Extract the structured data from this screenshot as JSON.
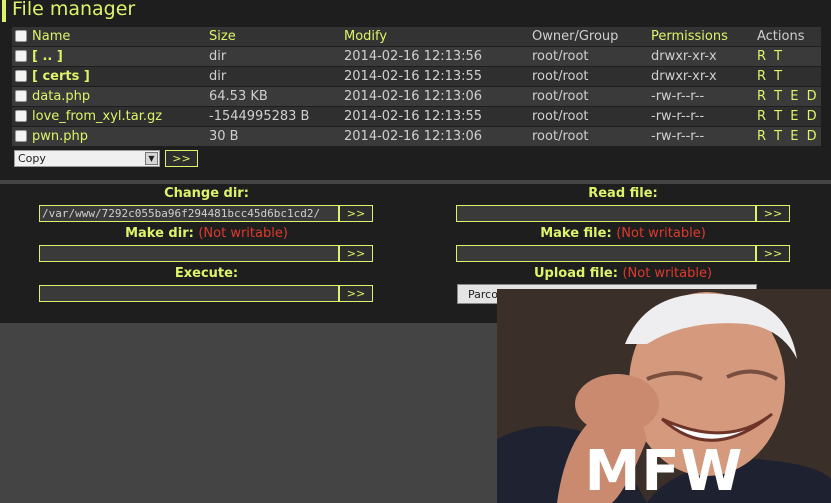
{
  "window": {
    "title": "File manager"
  },
  "table": {
    "headers": {
      "name": "Name",
      "size": "Size",
      "modify": "Modify",
      "owner": "Owner/Group",
      "permissions": "Permissions",
      "actions": "Actions"
    },
    "rows": [
      {
        "name": "[ .. ]",
        "size": "dir",
        "modify": "2014-02-16 12:13:56",
        "owner": "root/root",
        "permissions": "drwxr-xr-x",
        "actions": "R T"
      },
      {
        "name": "[ certs ]",
        "size": "dir",
        "modify": "2014-02-16 12:13:55",
        "owner": "root/root",
        "permissions": "drwxr-xr-x",
        "actions": "R T"
      },
      {
        "name": "data.php",
        "size": "64.53 KB",
        "modify": "2014-02-16 12:13:06",
        "owner": "root/root",
        "permissions": "-rw-r--r--",
        "actions": "R T E D"
      },
      {
        "name": "love_from_xyl.tar.gz",
        "size": "-1544995283 B",
        "modify": "2014-02-16 12:13:55",
        "owner": "root/root",
        "permissions": "-rw-r--r--",
        "actions": "R T E D"
      },
      {
        "name": "pwn.php",
        "size": "30 B",
        "modify": "2014-02-16 12:13:06",
        "owner": "root/root",
        "permissions": "-rw-r--r--",
        "actions": "R T E D"
      }
    ]
  },
  "bulk": {
    "selected": "Copy",
    "submit": ">>"
  },
  "tools": {
    "change_dir": {
      "label": "Change dir:",
      "value": "/var/www/7292c055ba96f294481bcc45d6bc1cd2/",
      "submit": ">>"
    },
    "read_file": {
      "label": "Read file:",
      "value": "",
      "submit": ">>"
    },
    "make_dir": {
      "label": "Make dir:",
      "warning": "(Not writable)",
      "value": "",
      "submit": ">>"
    },
    "make_file": {
      "label": "Make file:",
      "warning": "(Not writable)",
      "value": "",
      "submit": ">>"
    },
    "execute": {
      "label": "Execute:",
      "value": "",
      "submit": ">>"
    },
    "upload_file": {
      "label": "Upload file:",
      "warning": "(Not writable)",
      "browse": "Parcourir..."
    }
  },
  "meme": {
    "caption": "MFW"
  },
  "colors": {
    "accent": "#dff36a",
    "warning": "#dd3a2e",
    "panel": "#1e1e1e",
    "page": "#444444"
  }
}
